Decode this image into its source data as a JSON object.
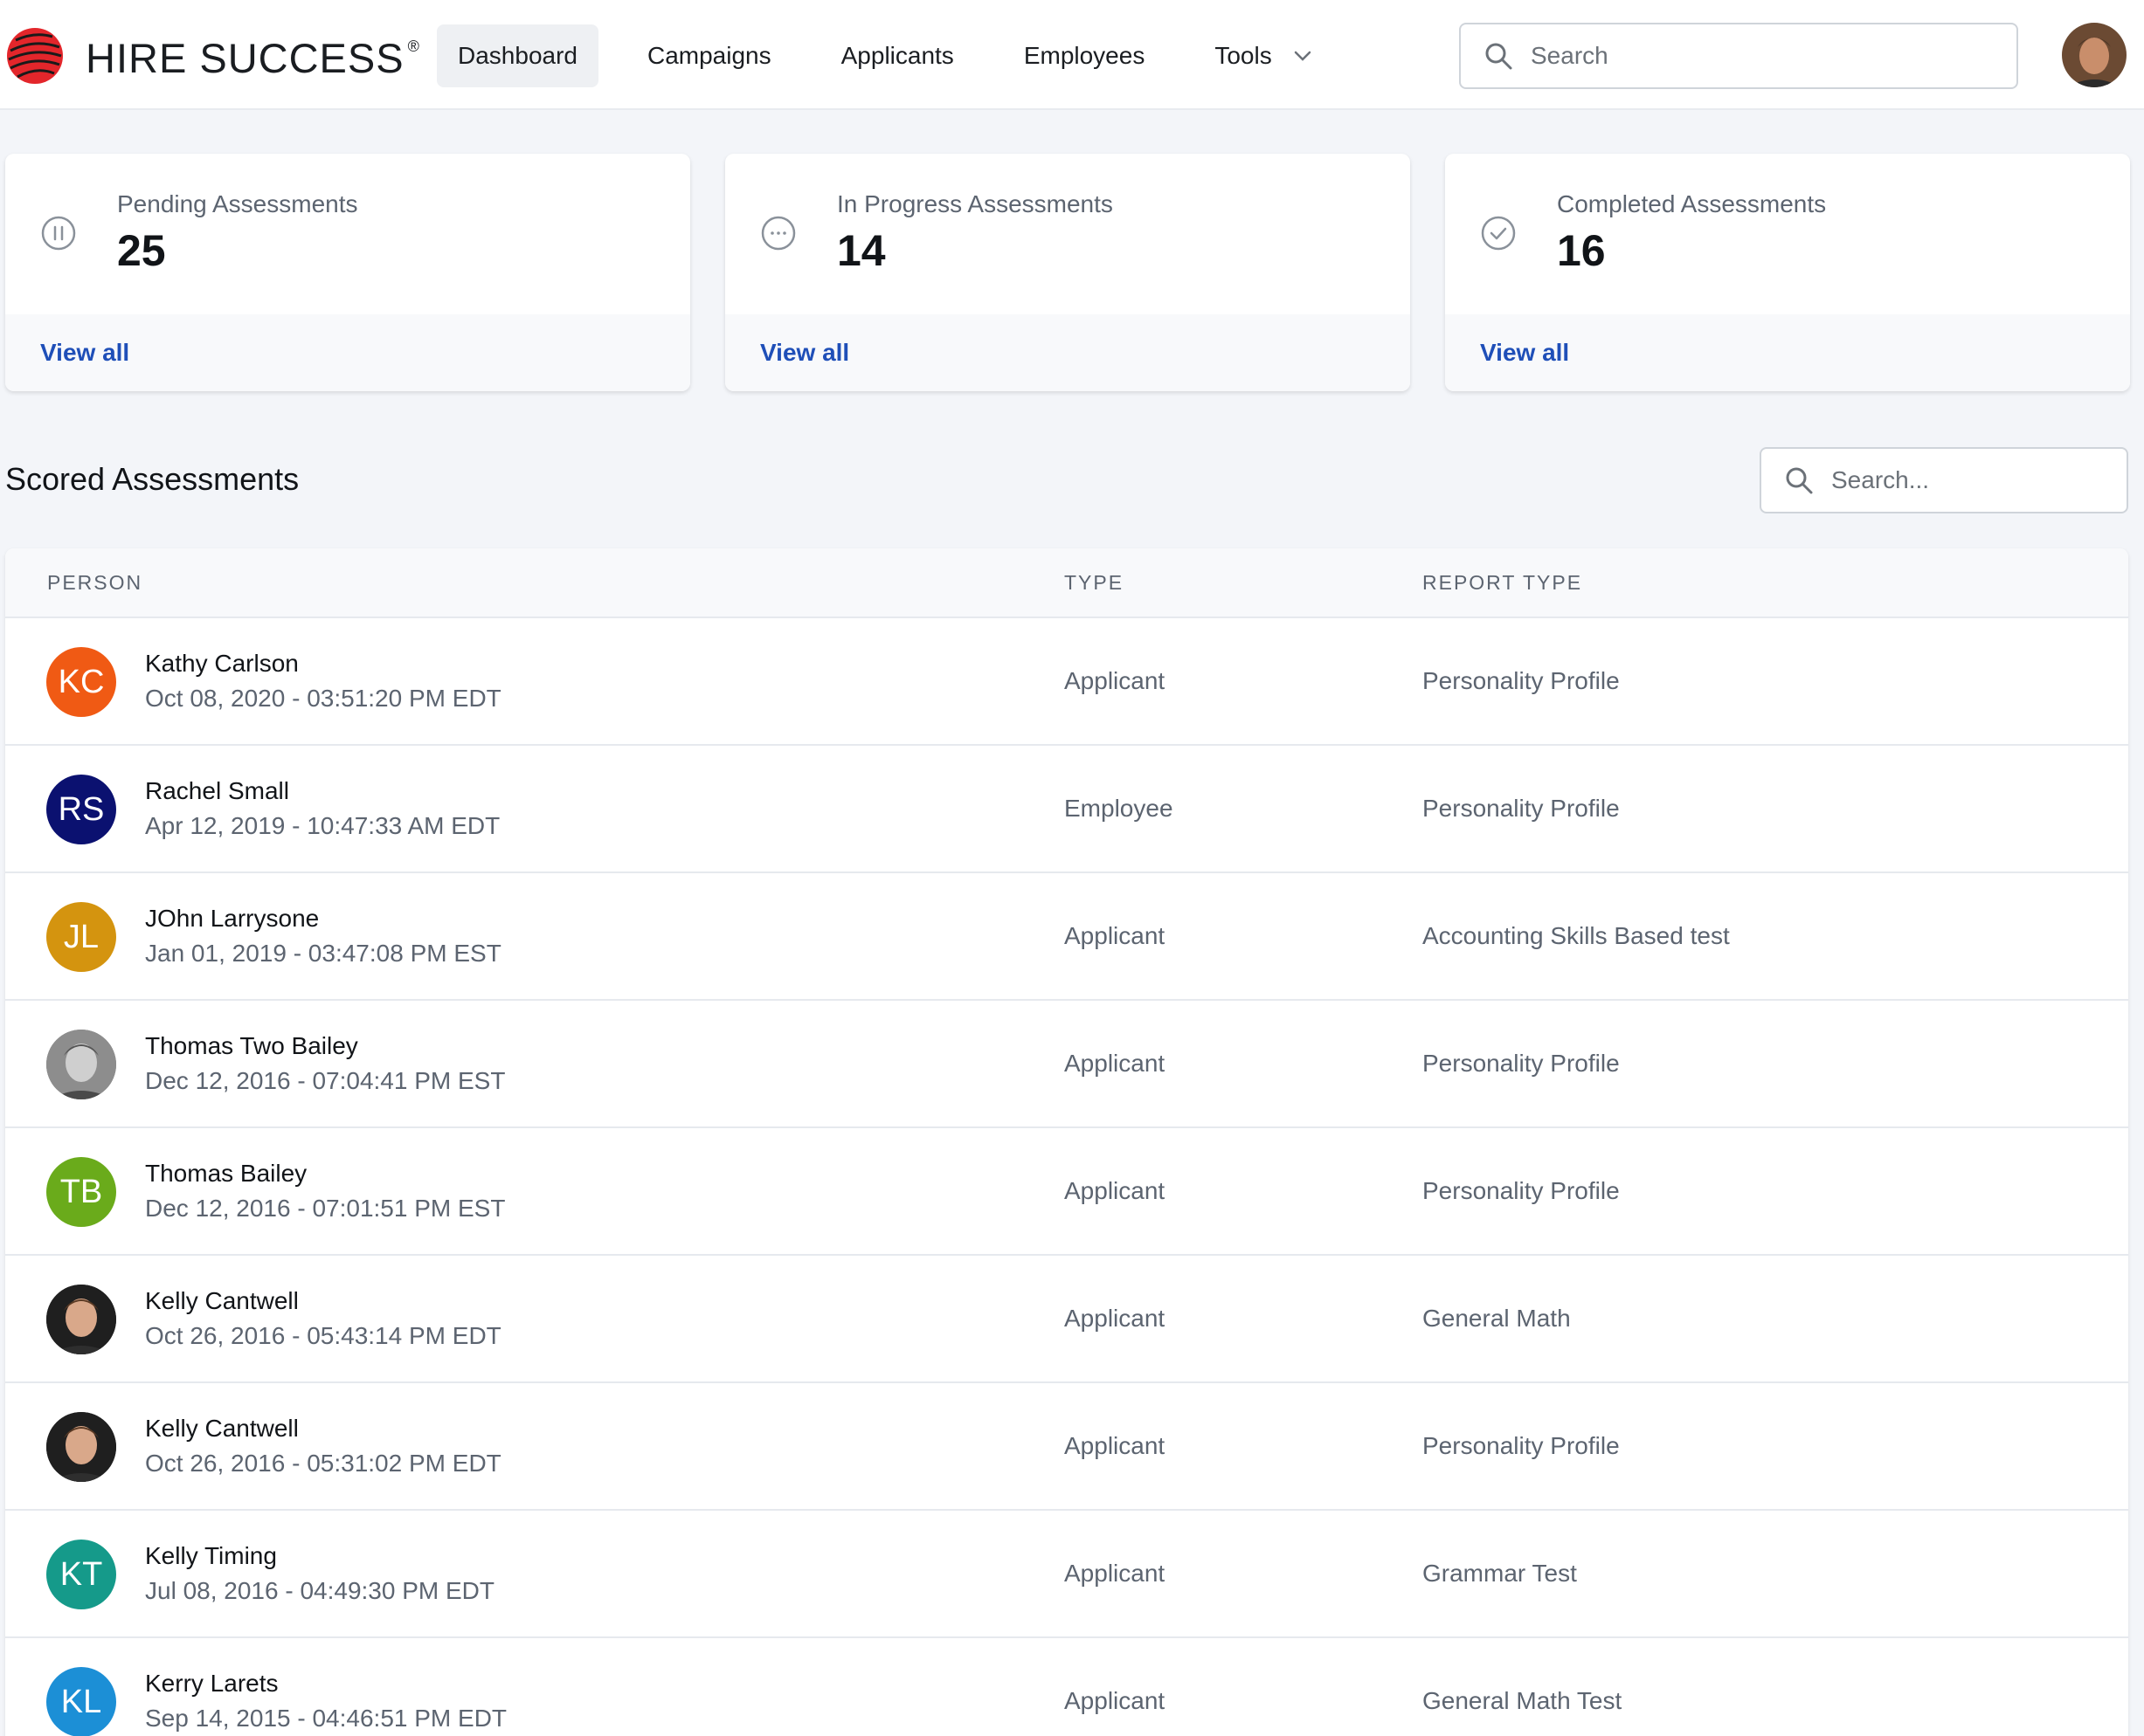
{
  "header": {
    "brand": "HIRE SUCCESS",
    "brand_mark": "®",
    "nav": [
      {
        "label": "Dashboard",
        "active": true
      },
      {
        "label": "Campaigns",
        "active": false
      },
      {
        "label": "Applicants",
        "active": false
      },
      {
        "label": "Employees",
        "active": false
      },
      {
        "label": "Tools",
        "active": false,
        "dropdown": true
      }
    ],
    "search_placeholder": "Search",
    "user_avatar": "user-photo"
  },
  "stats": [
    {
      "label": "Pending Assessments",
      "value": "25",
      "link": "View all",
      "icon": "pause-circle-icon"
    },
    {
      "label": "In Progress Assessments",
      "value": "14",
      "link": "View all",
      "icon": "ellipsis-circle-icon"
    },
    {
      "label": "Completed Assessments",
      "value": "16",
      "link": "View all",
      "icon": "check-circle-icon"
    }
  ],
  "section": {
    "title": "Scored Assessments",
    "search_placeholder": "Search..."
  },
  "table": {
    "columns": [
      "PERSON",
      "TYPE",
      "REPORT TYPE"
    ],
    "rows": [
      {
        "initials": "KC",
        "avatar_color": "#f05a14",
        "photo": false,
        "name": "Kathy Carlson",
        "date": "Oct 08, 2020 - 03:51:20 PM EDT",
        "type": "Applicant",
        "report": "Personality Profile"
      },
      {
        "initials": "RS",
        "avatar_color": "#0b1170",
        "photo": false,
        "name": "Rachel Small",
        "date": "Apr 12, 2019 - 10:47:33 AM EDT",
        "type": "Employee",
        "report": "Personality Profile"
      },
      {
        "initials": "JL",
        "avatar_color": "#d4940f",
        "photo": false,
        "name": "JOhn Larrysone",
        "date": "Jan 01, 2019 - 03:47:08 PM EST",
        "type": "Applicant",
        "report": "Accounting Skills Based test"
      },
      {
        "initials": "",
        "avatar_color": "#6f6f6f",
        "photo": true,
        "name": "Thomas Two Bailey",
        "date": "Dec 12, 2016 - 07:04:41 PM EST",
        "type": "Applicant",
        "report": "Personality Profile"
      },
      {
        "initials": "TB",
        "avatar_color": "#6aab1b",
        "photo": false,
        "name": "Thomas Bailey",
        "date": "Dec 12, 2016 - 07:01:51 PM EST",
        "type": "Applicant",
        "report": "Personality Profile"
      },
      {
        "initials": "",
        "avatar_color": "#2a2a2a",
        "photo": true,
        "name": "Kelly Cantwell",
        "date": "Oct 26, 2016 - 05:43:14 PM EDT",
        "type": "Applicant",
        "report": "General Math"
      },
      {
        "initials": "",
        "avatar_color": "#2a2a2a",
        "photo": true,
        "name": "Kelly Cantwell",
        "date": "Oct 26, 2016 - 05:31:02 PM EDT",
        "type": "Applicant",
        "report": "Personality Profile"
      },
      {
        "initials": "KT",
        "avatar_color": "#159a8a",
        "photo": false,
        "name": "Kelly Timing",
        "date": "Jul 08, 2016 - 04:49:30 PM EDT",
        "type": "Applicant",
        "report": "Grammar Test"
      },
      {
        "initials": "KL",
        "avatar_color": "#1c8fd6",
        "photo": false,
        "name": "Kerry Larets",
        "date": "Sep 14, 2015 - 04:46:51 PM EDT",
        "type": "Applicant",
        "report": "General Math Test"
      }
    ]
  },
  "colors": {
    "accent_link": "#1f4fb8",
    "page_bg": "#f3f5f9",
    "logo_red": "#e3262b"
  }
}
